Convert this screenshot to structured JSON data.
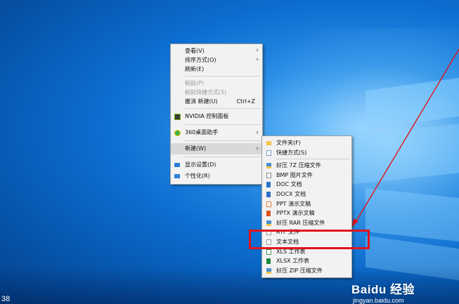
{
  "context_menu": {
    "items": [
      {
        "label": "查看(V)",
        "arrow": "›"
      },
      {
        "label": "排序方式(O)",
        "arrow": "›"
      },
      {
        "label": "刷新(E)"
      },
      {
        "label": "粘贴(P)"
      },
      {
        "label": "粘贴快捷方式(S)"
      },
      {
        "label": "撤消 新建(U)",
        "shortcut": "Ctrl+Z"
      },
      {
        "label": "NVIDIA 控制面板"
      },
      {
        "label": "360桌面助手",
        "arrow": "›"
      },
      {
        "label": "新建(W)",
        "arrow": "›"
      },
      {
        "label": "显示设置(D)"
      },
      {
        "label": "个性化(R)"
      }
    ]
  },
  "new_submenu": {
    "items": [
      {
        "label": "文件夹(F)"
      },
      {
        "label": "快捷方式(S)"
      },
      {
        "label": "好压 7Z 压缩文件"
      },
      {
        "label": "BMP 图片文件"
      },
      {
        "label": "DOC 文档"
      },
      {
        "label": "DOCX 文档"
      },
      {
        "label": "PPT 演示文稿"
      },
      {
        "label": "PPTX 演示文稿"
      },
      {
        "label": "好压 RAR 压缩文件"
      },
      {
        "label": "RTF 文件"
      },
      {
        "label": "文本文档"
      },
      {
        "label": "XLS 工作表"
      },
      {
        "label": "XLSX 工作表"
      },
      {
        "label": "好压 ZIP 压缩文件"
      }
    ]
  },
  "watermark": {
    "logo": "Baidu 经验",
    "url": "jingyan.baidu.com"
  },
  "taskbar": {
    "clock": "38"
  },
  "colors": {
    "annotation": "#e0141e",
    "highlight": "#d9d9d9",
    "menu_bg": "#f2f2f2"
  }
}
